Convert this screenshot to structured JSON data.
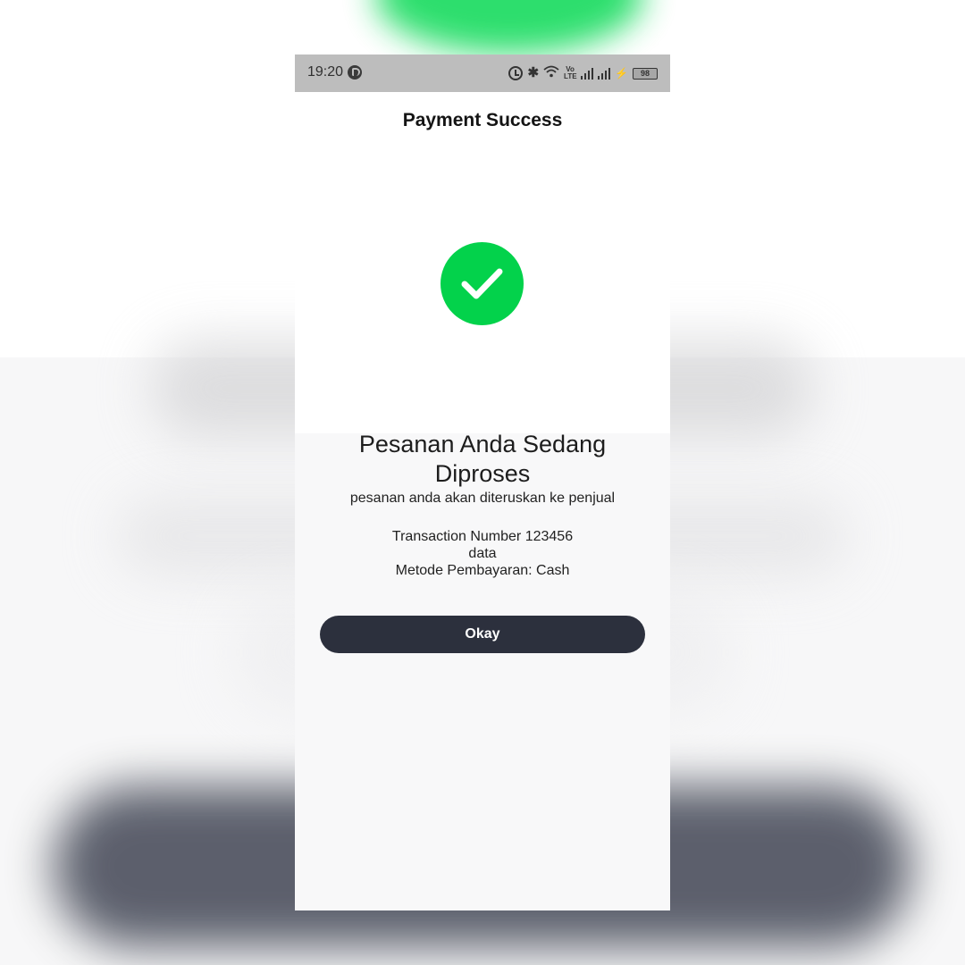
{
  "status_bar": {
    "time": "19:20",
    "lte_label": "Vo LTE",
    "battery": "98",
    "icons": [
      "app-notification-icon",
      "alarm-icon",
      "bluetooth-icon",
      "wifi-icon",
      "lte-icon",
      "signal-icon",
      "charging-icon",
      "battery-icon"
    ]
  },
  "header": {
    "title": "Payment Success"
  },
  "success": {
    "icon": "check-circle-icon",
    "color": "#03d24b"
  },
  "message": {
    "heading": "Pesanan Anda Sedang Diproses",
    "subtext": "pesanan anda akan diteruskan ke penjual"
  },
  "details": {
    "transaction": "Transaction Number 123456",
    "data": "data",
    "payment_method": "Metode Pembayaran: Cash"
  },
  "actions": {
    "okay_label": "Okay",
    "button_color": "#2c303d"
  }
}
